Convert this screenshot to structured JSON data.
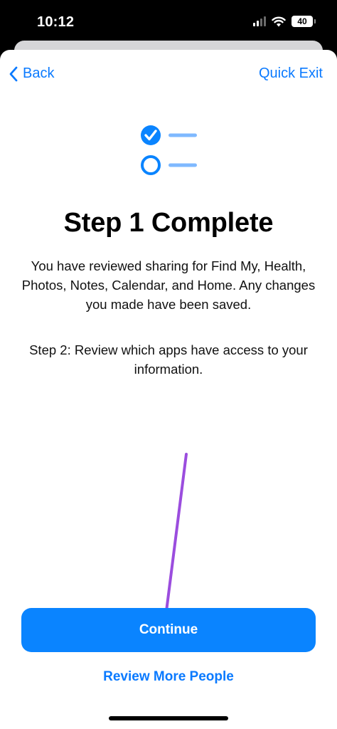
{
  "status_bar": {
    "time": "10:12",
    "battery": "40"
  },
  "nav": {
    "back_label": "Back",
    "quick_exit_label": "Quick Exit"
  },
  "content": {
    "title": "Step 1 Complete",
    "description": "You have reviewed sharing for Find My, Health, Photos, Notes, Calendar, and Home. Any changes you made have been saved.",
    "step2": "Step 2: Review which apps have access to your information."
  },
  "actions": {
    "continue_label": "Continue",
    "review_more_label": "Review More People"
  },
  "colors": {
    "accent": "#0a84ff",
    "link": "#0a7aff",
    "arrow": "#9b4dde"
  },
  "icons": [
    "chevron-left-icon",
    "checklist-icon",
    "wifi-icon",
    "signal-icon",
    "battery-icon"
  ]
}
